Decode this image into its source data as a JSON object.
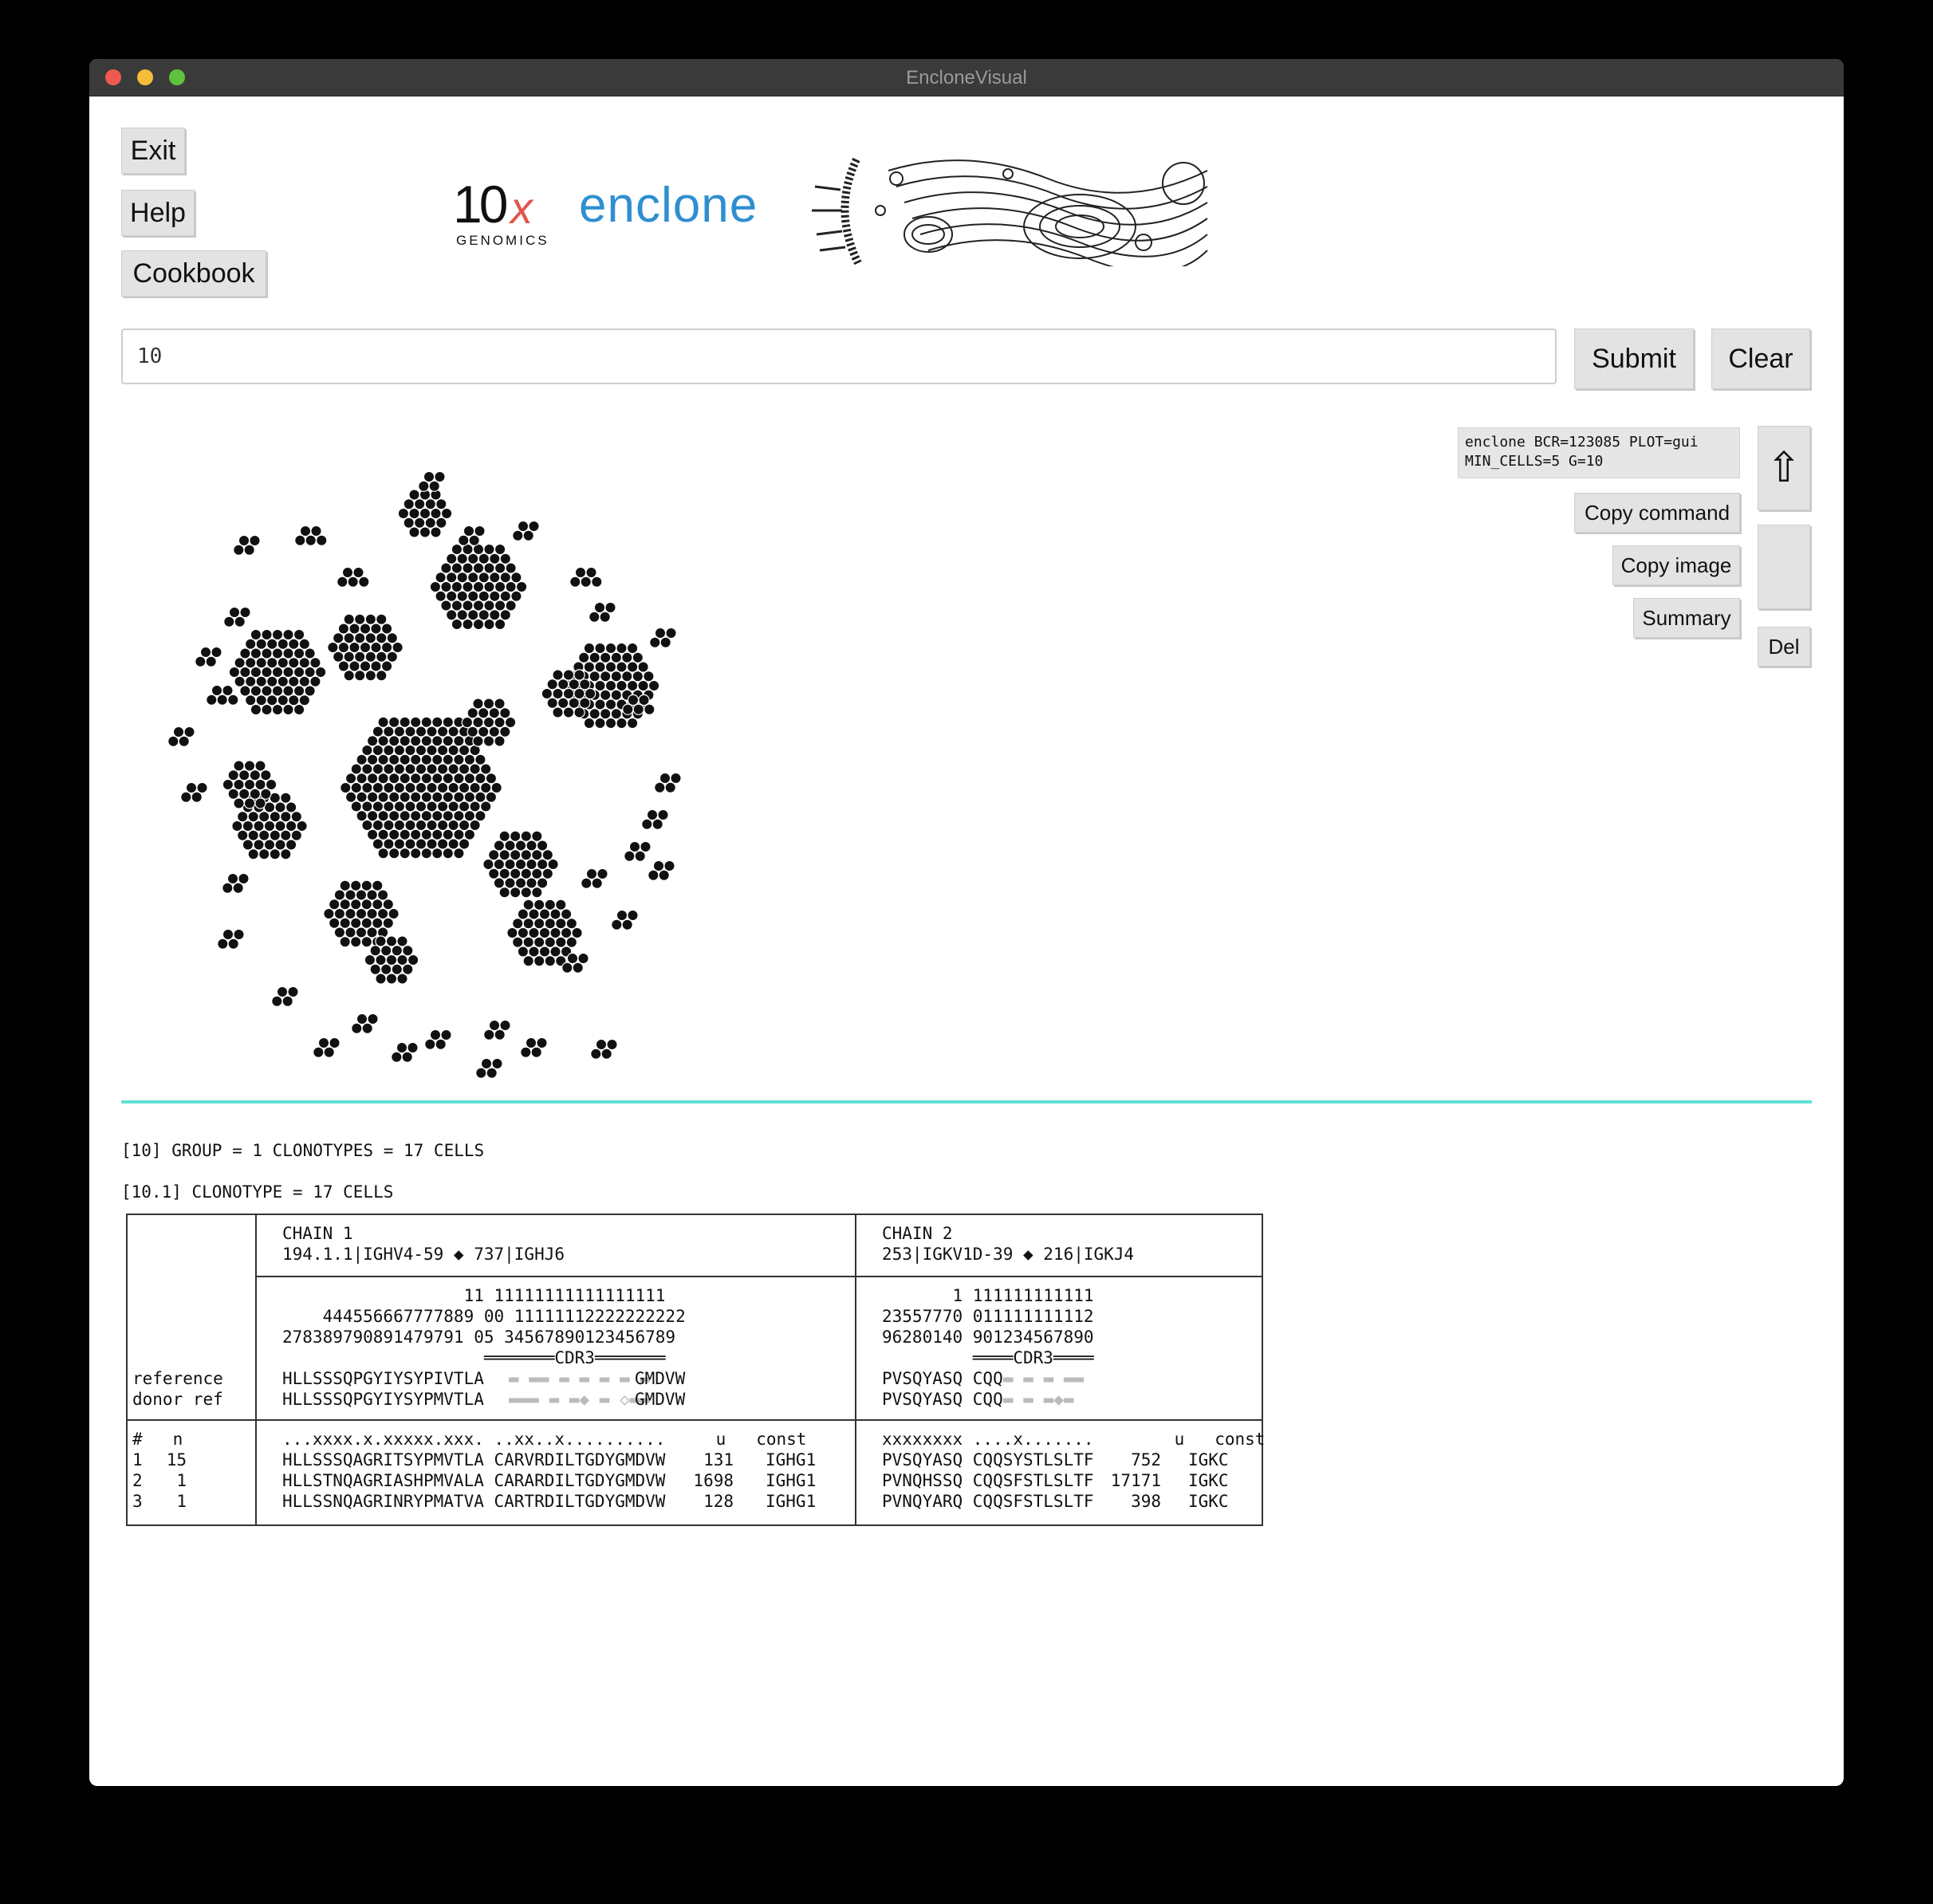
{
  "window": {
    "title": "EncloneVisual"
  },
  "buttons": {
    "exit": "Exit",
    "help": "Help",
    "cookbook": "Cookbook",
    "submit": "Submit",
    "clear": "Clear",
    "copy_command": "Copy command",
    "copy_image": "Copy image",
    "summary": "Summary",
    "del": "Del",
    "up_arrow": "⇧"
  },
  "logo": {
    "tenx_main": "10",
    "tenx_x": "x",
    "tenx_sub": "GENOMICS",
    "enclone": "enclone"
  },
  "command_input": {
    "value": "10"
  },
  "command_display": "enclone BCR=123085 PLOT=gui\nMIN_CELLS=5 G=10",
  "colors": {
    "accent_line": "#64e0d4",
    "enclone_blue": "#2f8fd0"
  },
  "icons": [
    "up-arrow-icon"
  ],
  "clonotype_header": {
    "group_line": "[10] GROUP = 1 CLONOTYPES = 17 CELLS",
    "clonotype_line": "[10.1] CLONOTYPE = 17 CELLS"
  },
  "table": {
    "chain1_header": "CHAIN 1\n194.1.1|IGHV4-59 ◆ 737|IGHJ6",
    "chain2_header": "CHAIN 2\n253|IGKV1D-39 ◆ 216|IGKJ4",
    "left_labels": "reference\ndonor ref",
    "chain1_positions": "                  11 1111111111111111\n     4445566677778890 1111111222222222\n278389790891479791 05 345678901234567 89",
    "chain1_pos_line1": "                  11 11111111111111111",
    "chain1_pos_line2": "    444556667777889 00 11111112222222222",
    "chain1_pos_line3": "278389790891479791 05 34567890123456789",
    "chain1_cdr3": "                    ═══════CDR3═══════",
    "chain1_reference": "HLLSSSQPGYIYSYPIVTLA",
    "chain1_reference_tail": "GMDVW",
    "chain1_donor": "HLLSSSQPGYIYSYPMVTLA",
    "chain1_donor_tail": "GMDVW",
    "chain2_pos_line1": "       1 111111111111",
    "chain2_pos_line2": "23557770 011111111112",
    "chain2_pos_line3": "96280140 901234567890",
    "chain2_cdr3": "         ════CDR3════",
    "chain2_reference": "PVSQYASQ CQQ",
    "chain2_donor": "PVSQYASQ CQQ",
    "row_header_left": "#   n",
    "chain1_row_header": "...xxxx.x.xxxxx.xxx. ..xx..x..........     u   const",
    "chain2_row_header": "xxxxxxxx ....x.......        u   const",
    "rows": [
      {
        "num": "1",
        "n": "15",
        "c1": "HLLSSSQAGRITSYPMVTLA CARVRDILTGDYGMDVW",
        "c1_u": "131",
        "c1_const": "IGHG1",
        "c2": "PVSQYASQ CQQSYSTLSLTF",
        "c2_u": "752",
        "c2_const": "IGKC"
      },
      {
        "num": "2",
        "n": "1",
        "c1": "HLLSTNQAGRIASHPMVALA CARARDILTGDYGMDVW",
        "c1_u": "1698",
        "c1_const": "IGHG1",
        "c2": "PVNQHSSQ CQQSFSTLSLTF",
        "c2_u": "17171",
        "c2_const": "IGKC"
      },
      {
        "num": "3",
        "n": "1",
        "c1": "HLLSSNQAGRINRYPMATVA CARTRDILTGDYGMDVW",
        "c1_u": "128",
        "c1_const": "IGHG1",
        "c2": "PVNQYARQ CQQSFSTLSLTF",
        "c2_u": "398",
        "c2_const": "IGKC"
      }
    ]
  }
}
